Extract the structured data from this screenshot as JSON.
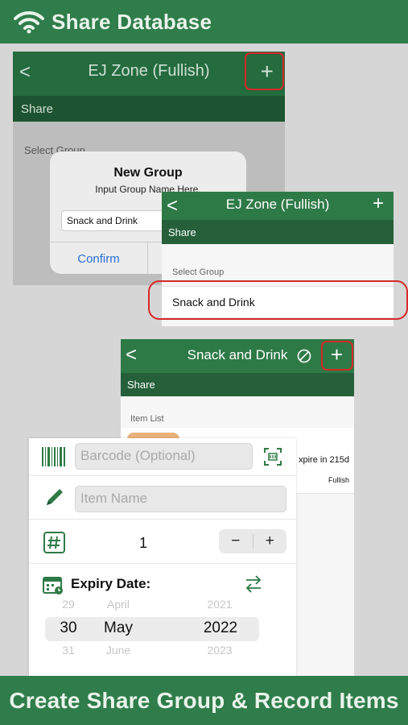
{
  "banner_top": {
    "title": "Share Database"
  },
  "banner_bottom": {
    "text": "Create Share Group & Record Items"
  },
  "screen1": {
    "nav_title": "EJ Zone (Fullish)",
    "sub_title": "Share",
    "select_label": "Select Group",
    "dialog": {
      "title": "New Group",
      "subtitle": "Input Group Name Here.",
      "input_value": "Snack and Drink",
      "confirm_label": "Confirm"
    }
  },
  "screen2": {
    "nav_title": "EJ Zone (Fullish)",
    "sub_title": "Share",
    "select_label": "Select Group",
    "group_name": "Snack and Drink"
  },
  "screen3": {
    "nav_title": "Snack and Drink",
    "sub_title": "Share",
    "list_label": "Item List",
    "item_expire": "xpire in 215d",
    "item_owner": "Fullish"
  },
  "form": {
    "barcode_placeholder": "Barcode (Optional)",
    "item_name_placeholder": "Item Name",
    "quantity": "1",
    "minus": "−",
    "plus": "+",
    "expiry_label": "Expiry Date:",
    "picker": {
      "prev": [
        "29",
        "April",
        "2021"
      ],
      "current": [
        "30",
        "May",
        "2022"
      ],
      "next": [
        "31",
        "June",
        "2023"
      ]
    }
  },
  "colors": {
    "brand_green": "#2f7d4a",
    "highlight_red": "#d62828"
  }
}
